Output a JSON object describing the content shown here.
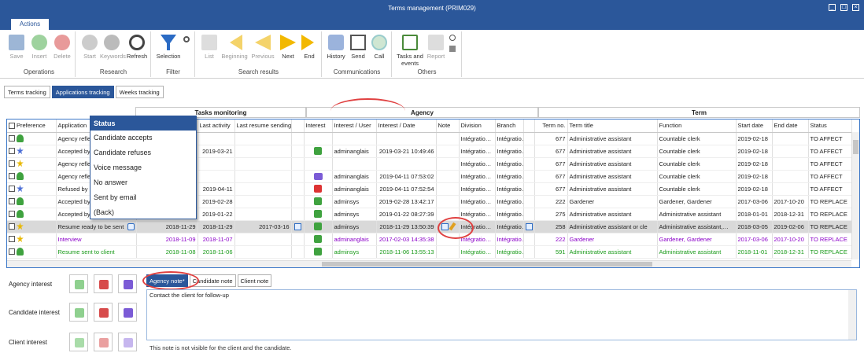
{
  "window": {
    "title": "Terms management (PRIM029)"
  },
  "ribbon_tab": "Actions",
  "ribbon": {
    "groups": [
      {
        "label": "Operations",
        "buttons": [
          "Save",
          "Insert",
          "Delete"
        ]
      },
      {
        "label": "Research",
        "buttons": [
          "Start",
          "Keywords",
          "Refresh"
        ]
      },
      {
        "label": "Filter",
        "buttons": [
          "Selection"
        ]
      },
      {
        "label": "Search results",
        "buttons": [
          "List",
          "Beginning",
          "Previous",
          "Next",
          "End"
        ]
      },
      {
        "label": "Communications",
        "buttons": [
          "History",
          "Send",
          "Call"
        ]
      },
      {
        "label": "Others",
        "buttons": [
          "Tasks and events",
          "Report"
        ]
      }
    ]
  },
  "subtabs": [
    "Terms tracking",
    "Applications tracking",
    "Weeks tracking"
  ],
  "bands": {
    "tasks": "Tasks monitoring",
    "agency": "Agency",
    "term": "Term"
  },
  "columns": [
    "Preference",
    "Application",
    "",
    "Last activity",
    "Last resume sending",
    "",
    "Interest",
    "Interest / User",
    "Interest / Date",
    "Note",
    "Division",
    "Branch",
    "",
    "Term no.",
    "Term title",
    "Function",
    "Start date",
    "End date",
    "Status"
  ],
  "rows": [
    {
      "app": "Agency refle",
      "c2": "",
      "last": "",
      "resume": "",
      "user": "",
      "date": "",
      "div": "Intégratio…",
      "branch": "Intégratio…",
      "no": "677",
      "title": "Administrative assistant",
      "func": "Countable clerk",
      "start": "2019-02-18",
      "end": "",
      "status": "TO AFFECT",
      "pin": "green",
      "interest": ""
    },
    {
      "app": "Accepted by",
      "c2": "",
      "last": "2019-03-21",
      "resume": "",
      "user": "adminanglais",
      "date": "2019-03-21 10:49:46",
      "div": "Intégratio…",
      "branch": "Intégratio…",
      "no": "677",
      "title": "Administrative assistant",
      "func": "Countable clerk",
      "start": "2019-02-18",
      "end": "",
      "status": "TO AFFECT",
      "pin": "blue",
      "interest": "up"
    },
    {
      "app": "Agency refle",
      "c2": "",
      "last": "",
      "resume": "",
      "user": "",
      "date": "",
      "div": "Intégratio…",
      "branch": "Intégratio…",
      "no": "677",
      "title": "Administrative assistant",
      "func": "Countable clerk",
      "start": "2019-02-18",
      "end": "",
      "status": "TO AFFECT",
      "pin": "yellow",
      "interest": ""
    },
    {
      "app": "Agency refle",
      "c2": "",
      "last": "",
      "resume": "",
      "user": "adminanglais",
      "date": "2019-04-11 07:53:02",
      "div": "Intégratio…",
      "branch": "Intégratio…",
      "no": "677",
      "title": "Administrative assistant",
      "func": "Countable clerk",
      "start": "2019-02-18",
      "end": "",
      "status": "TO AFFECT",
      "pin": "green",
      "interest": "bubble"
    },
    {
      "app": "Refused by",
      "c2": "",
      "last": "2019-04-11",
      "resume": "",
      "user": "adminanglais",
      "date": "2019-04-11 07:52:54",
      "div": "Intégratio…",
      "branch": "Intégratio…",
      "no": "677",
      "title": "Administrative assistant",
      "func": "Countable clerk",
      "start": "2019-02-18",
      "end": "",
      "status": "TO AFFECT",
      "pin": "blue",
      "interest": "down"
    },
    {
      "app": "Accepted by",
      "c2": "",
      "last": "2019-02-28",
      "resume": "",
      "user": "adminsys",
      "date": "2019-02-28 13:42:17",
      "div": "Intégratio…",
      "branch": "Intégratio…",
      "no": "222",
      "title": "Gardener",
      "func": "Gardener, Gardener",
      "start": "2017-03-06",
      "end": "2017-10-20",
      "status": "TO REPLACE",
      "pin": "green",
      "interest": "up"
    },
    {
      "app": "Accepted by",
      "c2": "",
      "last": "2019-01-22",
      "resume": "",
      "user": "adminsys",
      "date": "2019-01-22 08:27:39",
      "div": "Intégratio…",
      "branch": "Intégratio…",
      "no": "275",
      "title": "Administrative assistant",
      "func": "Administrative assistant",
      "start": "2018-01-01",
      "end": "2018-12-31",
      "status": "TO REPLACE",
      "pin": "green",
      "interest": "up"
    },
    {
      "app": "Resume ready to be sent",
      "c2": "2018-11-29",
      "last": "2018-11-29",
      "resume": "2017-03-16",
      "user": "adminsys",
      "date": "2018-11-29 13:50:39",
      "div": "Intégratio…",
      "branch": "Intégratio…",
      "no": "258",
      "title": "Administrative assistant or cle",
      "func": "Administrative assistant,…",
      "start": "2018-03-05",
      "end": "2019-02-06",
      "status": "TO REPLACE",
      "pin": "yellow",
      "interest": "up",
      "selected": true
    },
    {
      "app": "Interview",
      "c2": "2018-11-09",
      "last": "2018-11-07",
      "resume": "",
      "user": "adminanglais",
      "date": "2017-02-03 14:35:38",
      "div": "Intégratio…",
      "branch": "Intégratio…",
      "no": "222",
      "title": "Gardener",
      "func": "Gardener, Gardener",
      "start": "2017-03-06",
      "end": "2017-10-20",
      "status": "TO REPLACE",
      "pin": "yellow",
      "interest": "up",
      "color": "purple"
    },
    {
      "app": "Resume sent to client",
      "c2": "2018-11-08",
      "last": "2018-11-06",
      "resume": "",
      "user": "adminsys",
      "date": "2018-11-06 13:55:13",
      "div": "Intégratio…",
      "branch": "Intégratio…",
      "no": "591",
      "title": "Administrative assistant",
      "func": "Administrative assistant",
      "start": "2018-11-01",
      "end": "2018-12-31",
      "status": "TO REPLACE",
      "pin": "green",
      "interest": "up",
      "color": "green"
    }
  ],
  "status_menu": {
    "title": "Status",
    "items": [
      "Candidate accepts",
      "Candidate refuses",
      "Voice message",
      "No answer",
      "Sent by email",
      "(Back)"
    ]
  },
  "interest_panel": [
    "Agency interest",
    "Candidate interest",
    "Client interest"
  ],
  "note_tabs": [
    "Agency note*",
    "Candidate note",
    "Client note"
  ],
  "note_text": "Contact the client for follow-up",
  "note_notice": "This note is not visible for the client and the candidate."
}
